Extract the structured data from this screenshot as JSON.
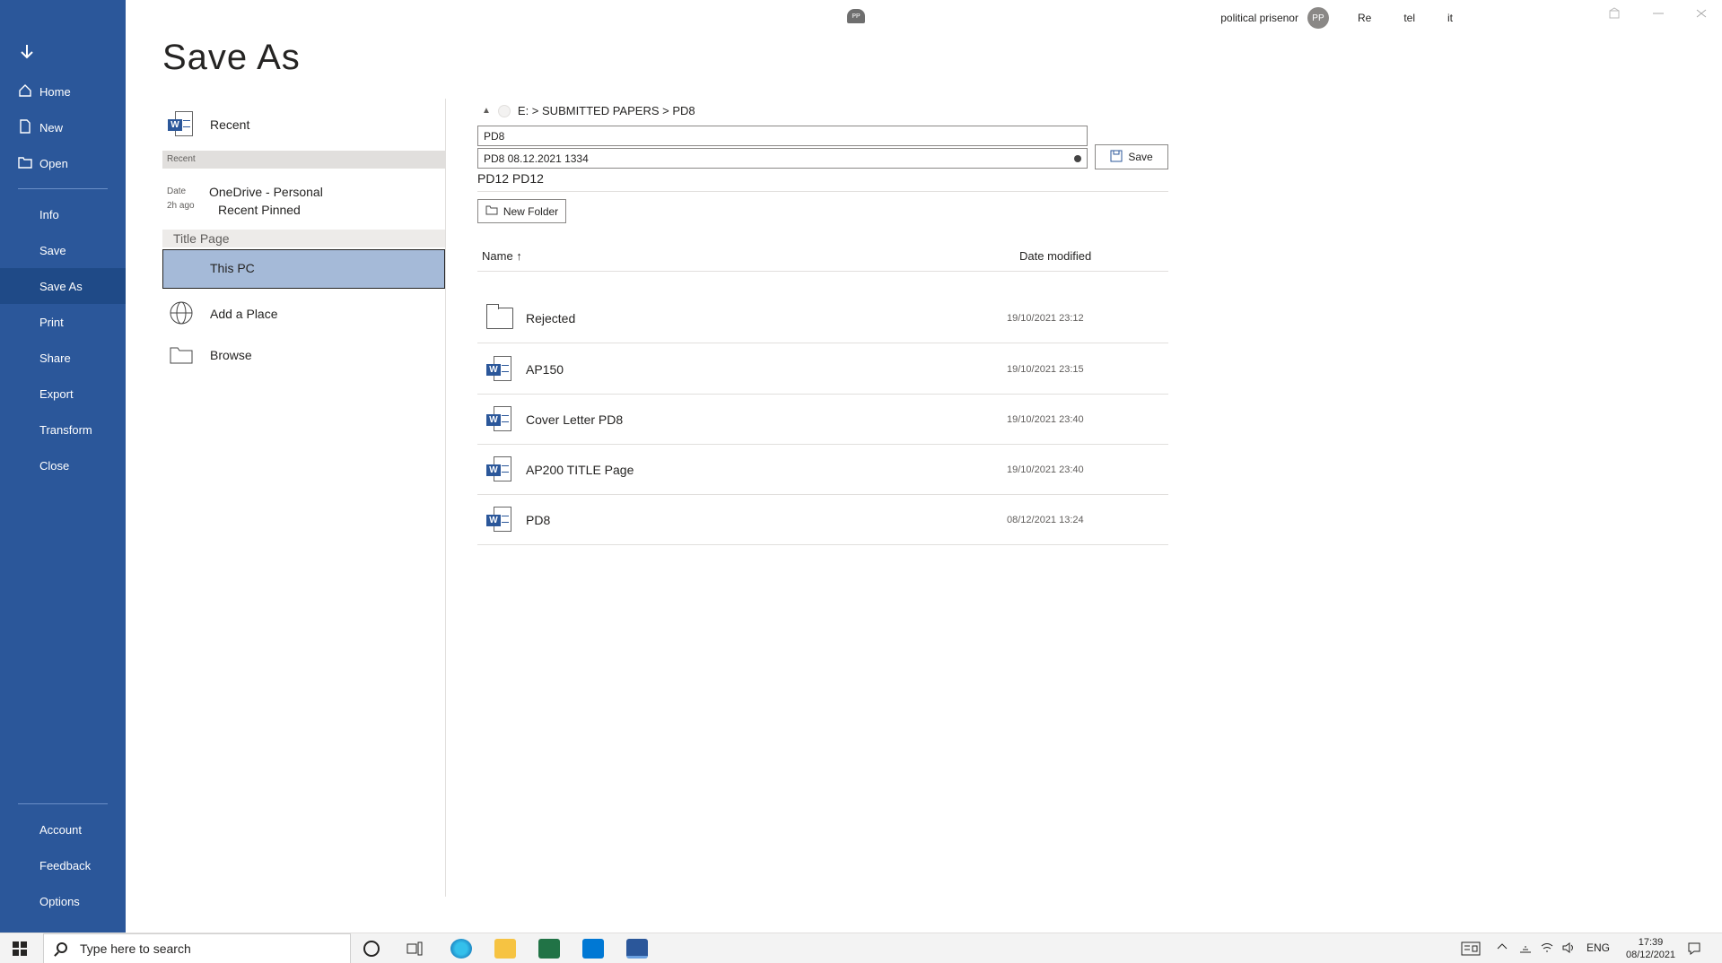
{
  "app": {
    "page_title": "Save As",
    "user_name": "political prisenor",
    "user_initials": "PP",
    "share_badge": "PP",
    "header_icons": [
      "Re",
      "tel",
      "it"
    ]
  },
  "sidebar": {
    "items": [
      {
        "label": "Home",
        "icon": "home-icon"
      },
      {
        "label": "New",
        "icon": "new-document-icon"
      },
      {
        "label": "Open",
        "icon": "open-folder-icon"
      },
      {
        "label": "Info"
      },
      {
        "label": "Save"
      },
      {
        "label": "Save As",
        "active": true
      },
      {
        "label": "Print"
      },
      {
        "label": "Share"
      },
      {
        "label": "Export"
      },
      {
        "label": "Transform"
      },
      {
        "label": "Close"
      }
    ],
    "bottom": [
      {
        "label": "Account"
      },
      {
        "label": "Feedback"
      },
      {
        "label": "Options"
      }
    ]
  },
  "locations": {
    "recent": "Recent",
    "header_text": "Recent",
    "date_label": "Date",
    "time_ago": "2h ago",
    "onedrive": "OneDrive - Personal",
    "recent_pinned": "Recent Pinned",
    "title_page": "Title Page",
    "this_pc": "This PC",
    "add_place": "Add a Place",
    "browse": "Browse"
  },
  "save_panel": {
    "breadcrumb": "E: > SUBMITTED PAPERS > PD8",
    "up_label": "▲",
    "folder_field": "PD8",
    "filename_field": "PD8 08.12.2021 1334",
    "save_label": "Save",
    "format_label": "PD12 PD12",
    "new_folder_label": "New Folder",
    "col_name": "Name ↑",
    "col_date": "Date modified"
  },
  "files": [
    {
      "name": "Rejected",
      "date": "19/10/2021 23:12",
      "type": "folder"
    },
    {
      "name": "AP150",
      "date": "19/10/2021 23:15",
      "type": "word"
    },
    {
      "name": "Cover Letter PD8",
      "date": "19/10/2021 23:40",
      "type": "word"
    },
    {
      "name": "AP200 TITLE Page",
      "date": "19/10/2021 23:40",
      "type": "word"
    },
    {
      "name": "PD8",
      "date": "08/12/2021 13:24",
      "type": "word"
    }
  ],
  "taskbar": {
    "search_placeholder": "Type here to search",
    "lang": "ENG",
    "time": "17:39",
    "date": "08/12/2021"
  },
  "colors": {
    "sidebar": "#2b579a",
    "selected_location": "#a5bad8",
    "excel": "#217346",
    "outlook": "#0078d4",
    "word": "#2b579a"
  }
}
